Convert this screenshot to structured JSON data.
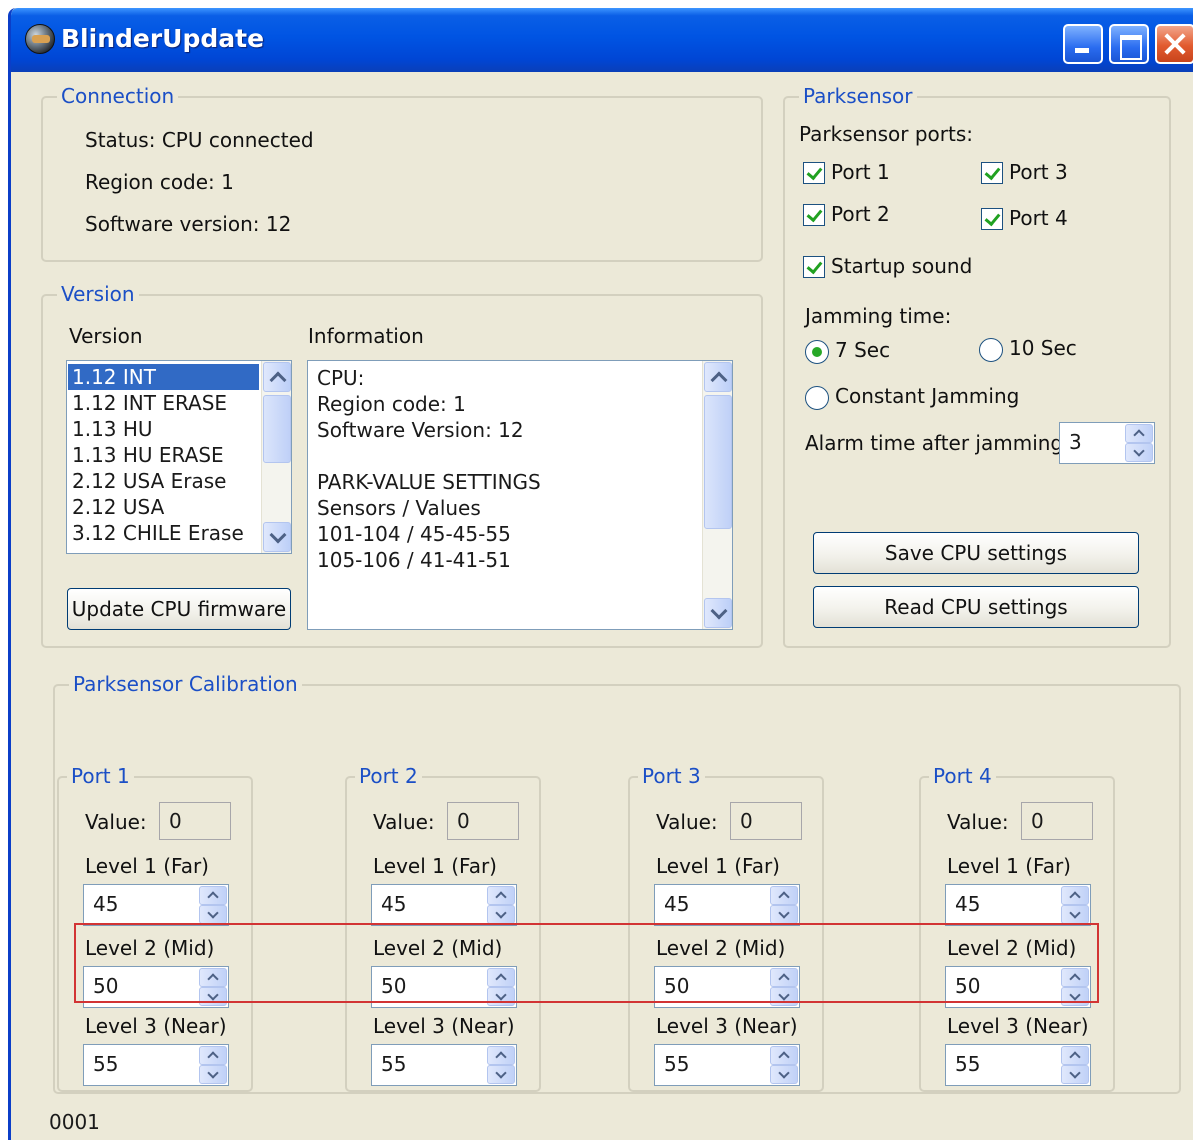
{
  "window": {
    "title": "BlinderUpdate",
    "icon": "app-icon"
  },
  "connection": {
    "legend": "Connection",
    "status": "Status:  CPU connected",
    "region": "Region code:  1",
    "software": "Software version:  12"
  },
  "version": {
    "legend": "Version",
    "list_header": "Version",
    "info_header": "Information",
    "items": [
      "1.12 INT",
      "1.12 INT ERASE",
      "1.13 HU",
      "1.13 HU ERASE",
      "2.12 USA Erase",
      "2.12 USA",
      "3.12 CHILE Erase"
    ],
    "selected_item": "1.12 INT",
    "info_lines": [
      "CPU:",
      "Region code:  1",
      "Software Version: 12",
      "",
      "PARK-VALUE SETTINGS",
      "Sensors / Values",
      "101-104 / 45-45-55",
      "105-106 / 41-41-51"
    ],
    "update_button": "Update CPU firmware"
  },
  "parksensor": {
    "legend": "Parksensor",
    "ports_label": "Parksensor ports:",
    "port1": "Port 1",
    "port2": "Port 2",
    "port3": "Port 3",
    "port4": "Port 4",
    "startup_sound": "Startup sound",
    "checked": {
      "port1": true,
      "port2": true,
      "port3": true,
      "port4": true,
      "startup_sound": true
    },
    "jamming_label": "Jamming time:",
    "radio_7sec": "7 Sec",
    "radio_10sec": "10 Sec",
    "radio_constant": "Constant Jamming",
    "selected_jamming": "7 Sec",
    "alarm_label": "Alarm time after jamming:",
    "alarm_value": "3",
    "save_button": "Save CPU settings",
    "read_button": "Read CPU settings"
  },
  "calibration": {
    "legend": "Parksensor Calibration",
    "value_label": "Value:",
    "level1_label": "Level 1 (Far)",
    "level2_label": "Level 2 (Mid)",
    "level3_label": "Level 3 (Near)",
    "ports": [
      {
        "name": "Port 1",
        "value": "0",
        "level1": "45",
        "level2": "50",
        "level3": "55"
      },
      {
        "name": "Port 2",
        "value": "0",
        "level1": "45",
        "level2": "50",
        "level3": "55"
      },
      {
        "name": "Port 3",
        "value": "0",
        "level1": "45",
        "level2": "50",
        "level3": "55"
      },
      {
        "name": "Port 4",
        "value": "0",
        "level1": "45",
        "level2": "50",
        "level3": "55"
      }
    ]
  },
  "status_bar": {
    "code": "0001"
  },
  "colors": {
    "titlebar": "#0054e3",
    "group_legend": "#1b4fc6",
    "selection": "#316ac5",
    "highlight": "#d23434",
    "window_bg": "#ece9d8"
  }
}
